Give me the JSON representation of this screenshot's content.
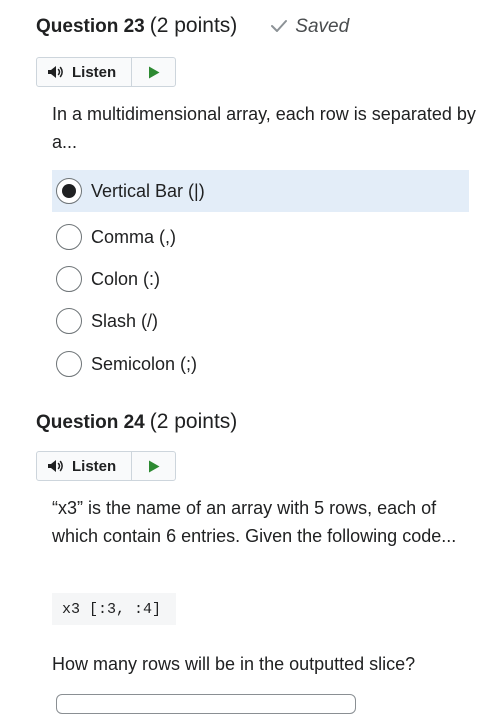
{
  "q23": {
    "title": "Question 23",
    "points": "(2 points)",
    "saved_label": "Saved",
    "listen_label": "Listen",
    "text": "In a multidimensional array, each row is separated by a...",
    "options": [
      {
        "label": "Vertical Bar (|)",
        "selected": true
      },
      {
        "label": "Comma (,)",
        "selected": false
      },
      {
        "label": "Colon (:)",
        "selected": false
      },
      {
        "label": "Slash (/)",
        "selected": false
      },
      {
        "label": "Semicolon (;)",
        "selected": false
      }
    ]
  },
  "q24": {
    "title": "Question 24",
    "points": "(2 points)",
    "listen_label": "Listen",
    "text": "“x3” is the name of an array with 5 rows, each of which contain 6 entries. Given the following code...",
    "code": "x3 [:3, :4]",
    "prompt": "How many rows will be in the outputted slice?"
  },
  "colors": {
    "accent_play": "#2d8a32",
    "selected_bg": "#e3edf8",
    "text": "#202122"
  },
  "icons": {
    "saved": "checkmark-icon",
    "listen": "speaker-icon",
    "play": "play-icon"
  }
}
